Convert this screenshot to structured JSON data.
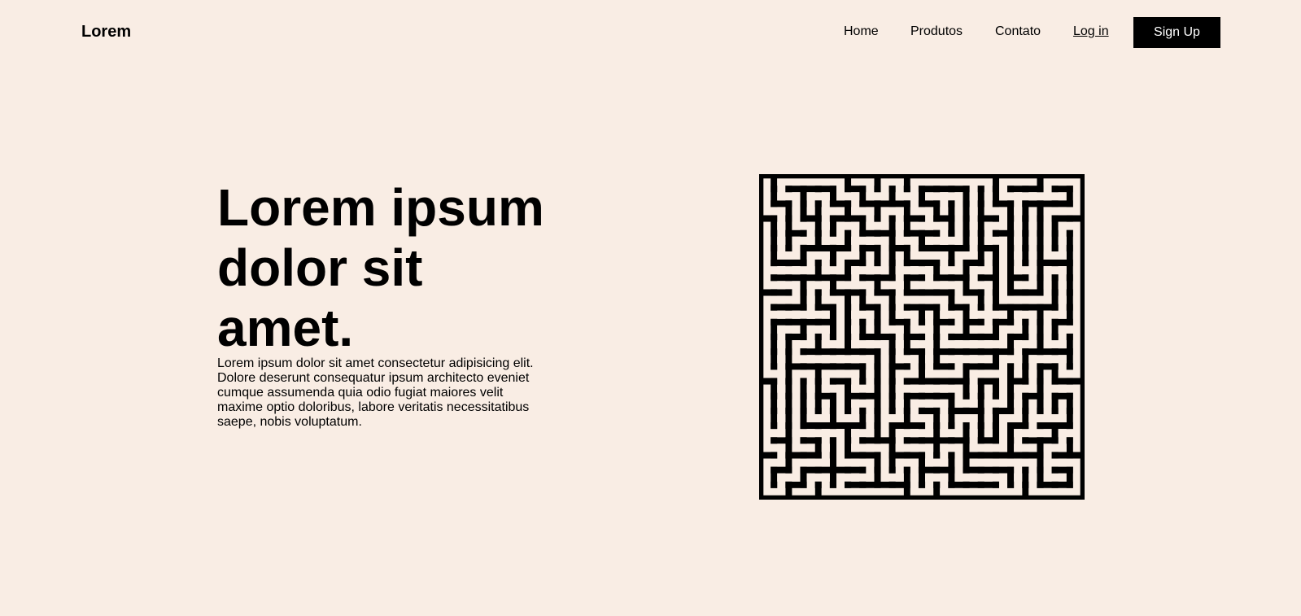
{
  "header": {
    "brand": "Lorem",
    "nav": {
      "home": "Home",
      "produtos": "Produtos",
      "contato": "Contato",
      "login": "Log in"
    },
    "signup_label": "Sign Up"
  },
  "hero": {
    "title": "Lorem ipsum dolor sit amet.",
    "text": "Lorem ipsum dolor sit amet consectetur adipisicing elit. Dolore deserunt consequatur ipsum architecto eveniet cumque assumenda quia odio fugiat maiores velit maxime optio doloribus, labore veritatis necessitatibus saepe, nobis voluptatum."
  },
  "colors": {
    "background": "#f9ede4",
    "text": "#000000",
    "button_bg": "#000000",
    "button_text": "#ffffff"
  },
  "illustration": {
    "name": "maze-illustration"
  }
}
